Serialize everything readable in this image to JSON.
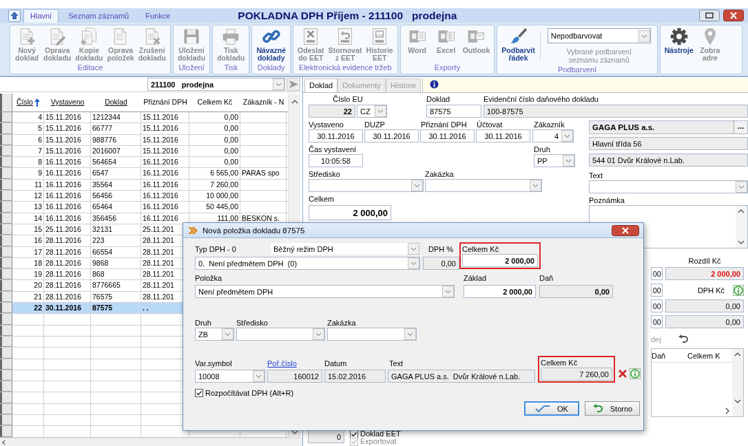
{
  "header": {
    "tabs": [
      {
        "label": "Hlavní",
        "selected": true
      },
      {
        "label": "Seznam záznamů",
        "selected": false
      },
      {
        "label": "Funkce",
        "selected": false
      }
    ],
    "title": "POKLADNA DPH Příjem - 211100   prodejna"
  },
  "ribbon": {
    "groups": [
      {
        "label": "Editace",
        "buttons": [
          {
            "label": "Nový\ndoklad",
            "disabled": true
          },
          {
            "label": "Oprava\ndokladu",
            "disabled": true
          },
          {
            "label": "Kopie\ndokladu",
            "disabled": true
          },
          {
            "label": "Oprava\npoložek",
            "disabled": true
          },
          {
            "label": "Zrušení\ndokladu",
            "disabled": true
          }
        ]
      },
      {
        "label": "Uložení",
        "buttons": [
          {
            "label": "Uložení\ndokladu",
            "disabled": true
          }
        ]
      },
      {
        "label": "Tisk",
        "buttons": [
          {
            "label": "Tisk\ndokladu",
            "disabled": true
          }
        ]
      },
      {
        "label": "Doklady",
        "buttons": [
          {
            "label": "Návazné\ndoklady",
            "disabled": false
          }
        ]
      },
      {
        "label": "Elektronická evidence tržeb",
        "buttons": [
          {
            "label": "Odeslat\ndo EET",
            "disabled": true
          },
          {
            "label": "Stornovat\nz EET",
            "disabled": true
          },
          {
            "label": "Historie\nEET",
            "disabled": true
          }
        ]
      },
      {
        "label": "Exporty",
        "buttons": [
          {
            "label": "Word",
            "disabled": true
          },
          {
            "label": "Excel",
            "disabled": true
          },
          {
            "label": "Outlook",
            "disabled": true
          }
        ]
      },
      {
        "label": "Podbarvení",
        "buttons": [
          {
            "label": "Podbarvit\nřádek",
            "disabled": false
          }
        ],
        "select": {
          "value": "Nepodbarvovat"
        },
        "caption": "Vybrané podbarvení\nseznamu záznamů"
      },
      {
        "buttons": [
          {
            "label": "Nástroje",
            "disabled": false
          },
          {
            "label": "Zobra\nadre",
            "disabled": true
          }
        ]
      }
    ]
  },
  "list": {
    "filter": {
      "value": "211100   prodejna"
    },
    "columns": [
      {
        "label": "Číslo",
        "sorted": true,
        "link": true
      },
      {
        "label": "Vystaveno",
        "sorted": false,
        "link": true
      },
      {
        "label": "Doklad",
        "sorted": false,
        "link": true
      },
      {
        "label": "Přiznání DPH",
        "sorted": false,
        "link": false
      },
      {
        "label": "Celkem Kč",
        "sorted": false,
        "link": false
      },
      {
        "label": "Zákazník - N",
        "sorted": false,
        "link": false
      }
    ],
    "rows": [
      {
        "cells": [
          "4",
          "15.11.2016",
          "1212344",
          "15.11.2016",
          "0,00"
        ],
        "selected": false
      },
      {
        "cells": [
          "5",
          "15.11.2016",
          "66777",
          "15.11.2016",
          "0,00"
        ],
        "selected": false
      },
      {
        "cells": [
          "6",
          "15.11.2016",
          "988776",
          "15.11.2016",
          "0,00"
        ],
        "selected": false
      },
      {
        "cells": [
          "7",
          "15.11.2016",
          "2016007",
          "15.11.2016",
          "0,00"
        ],
        "selected": false
      },
      {
        "cells": [
          "8",
          "16.11.2016",
          "564654",
          "16.11.2016",
          "0,00"
        ],
        "selected": false
      },
      {
        "cells": [
          "9",
          "16.11.2016",
          "6547",
          "16.11.2016",
          "6 565,00",
          "PARAS spo"
        ],
        "selected": false
      },
      {
        "cells": [
          "11",
          "16.11.2016",
          "35564",
          "16.11.2016",
          "7 260,00"
        ],
        "selected": false
      },
      {
        "cells": [
          "12",
          "16.11.2016",
          "56456",
          "16.11.2016",
          "10 000,00"
        ],
        "selected": false
      },
      {
        "cells": [
          "13",
          "16.11.2016",
          "65464",
          "16.11.2016",
          "50 445,00"
        ],
        "selected": false
      },
      {
        "cells": [
          "14",
          "16.11.2016",
          "356456",
          "16.11.2016",
          "111,00",
          "BESKON s."
        ],
        "selected": false
      },
      {
        "cells": [
          "15",
          "25.11.2016",
          "32131",
          "25.11.201"
        ],
        "selected": false
      },
      {
        "cells": [
          "16",
          "28.11.2016",
          "223",
          "28.11.201"
        ],
        "selected": false
      },
      {
        "cells": [
          "17",
          "28.11.2016",
          "66554",
          "28.11.201"
        ],
        "selected": false
      },
      {
        "cells": [
          "18",
          "28.11.2016",
          "9868",
          "28.11.201"
        ],
        "selected": false
      },
      {
        "cells": [
          "19",
          "28.11.2016",
          "868",
          "28.11.201"
        ],
        "selected": false
      },
      {
        "cells": [
          "20",
          "28.11.2016",
          "8776665",
          "28.11.201"
        ],
        "selected": false
      },
      {
        "cells": [
          "21",
          "28.11.2016",
          "76575",
          "28.11.201"
        ],
        "selected": false
      },
      {
        "cells": [
          "22",
          "30.11.2016",
          "87575",
          ". ."
        ],
        "selected": true
      }
    ]
  },
  "detail": {
    "tabs": [
      {
        "label": "Doklad",
        "selected": true
      },
      {
        "label": "Dokumenty",
        "selected": false
      },
      {
        "label": "Historie",
        "selected": false
      }
    ],
    "cislo_eu": {
      "label": "Číslo EU",
      "value": "22",
      "country": "CZ"
    },
    "doklad": {
      "label": "Doklad",
      "value": "87575"
    },
    "evidencni_cislo": {
      "label": "Evidenční číslo daňového dokladu",
      "value": "100-87575"
    },
    "dates": [
      {
        "label": "Vystaveno",
        "value": "30.11.2016"
      },
      {
        "label": "DUZP",
        "value": "30.11.2016"
      },
      {
        "label": "Přiznání DPH",
        "value": "30.11.2016"
      },
      {
        "label": "Účtovat",
        "value": "30.11.2016"
      }
    ],
    "zakaznik": {
      "label": "Zákazník",
      "value": "4"
    },
    "customer": {
      "name": "GAGA PLUS a.s.",
      "more": "...",
      "street": "Hlavní třída 56",
      "city": "544 01 Dvůr Králové n.Lab."
    },
    "cas_vystaveni": {
      "label": "Čas vystavení",
      "value": "10:05:58"
    },
    "druh": {
      "label": "Druh",
      "value": "PP"
    },
    "stredisko": {
      "label": "Středisko"
    },
    "zakazka": {
      "label": "Zakázka"
    },
    "text": {
      "label": "Text"
    },
    "celkem": {
      "label": "Celkem",
      "value": "2 000,00"
    },
    "poznamka": {
      "label": "Poznámka"
    },
    "summary": {
      "cut_fields": [
        "00",
        "00",
        "00",
        "00"
      ],
      "rozdil": {
        "label": "Rozdíl Kč",
        "value": "2 000,00"
      },
      "dph": {
        "label": "DPH Kč",
        "values": [
          "0,00",
          "0,00"
        ]
      },
      "cut_button": "dej",
      "items_columns": [
        "Daň",
        "Celkem K"
      ]
    }
  },
  "footer": {
    "count": "0",
    "checks": [
      {
        "label": "Doklad EET",
        "checked": true,
        "disabled": false
      },
      {
        "label": "Exportovat",
        "checked": true,
        "disabled": true
      }
    ]
  },
  "dialog": {
    "title": "Nová položka dokladu 87575",
    "typ_dph": {
      "label": "Typ DPH - 0",
      "mode": "Běžný režim DPH",
      "value": "0.  Není předmětem DPH  (0)"
    },
    "dph_pct": {
      "label": "DPH %",
      "value": "0,00"
    },
    "celkem": {
      "label": "Celkem Kč",
      "value": "2 000,00",
      "highlighted": true
    },
    "polozka": {
      "label": "Položka",
      "value": "Není předmětem DPH"
    },
    "zaklad": {
      "label": "Základ",
      "value": "2 000,00"
    },
    "dan": {
      "label": "Daň",
      "value": "0,00"
    },
    "druh": {
      "label": "Druh",
      "value": "ZB"
    },
    "stredisko": {
      "label": "Středisko"
    },
    "zakazka": {
      "label": "Zakázka"
    },
    "var_symbol": {
      "label": "Var.symbol",
      "value": "10008"
    },
    "por_cislo": {
      "label": "Poř.číslo",
      "value": "160012"
    },
    "datum": {
      "label": "Datum",
      "value": "15.02.2016"
    },
    "text": {
      "label": "Text",
      "value": "GAGA PLUS a.s.  Dvůr Králové n.Lab."
    },
    "celkem2": {
      "label": "Celkem Kč",
      "value": "7 260,00",
      "highlighted": true
    },
    "recalc": {
      "label": "Rozpočítávat DPH (Alt+R)",
      "checked": true
    },
    "buttons": [
      {
        "label": "OK",
        "kind": "ok",
        "default": true
      },
      {
        "label": "Storno",
        "kind": "cancel",
        "default": false
      }
    ]
  }
}
